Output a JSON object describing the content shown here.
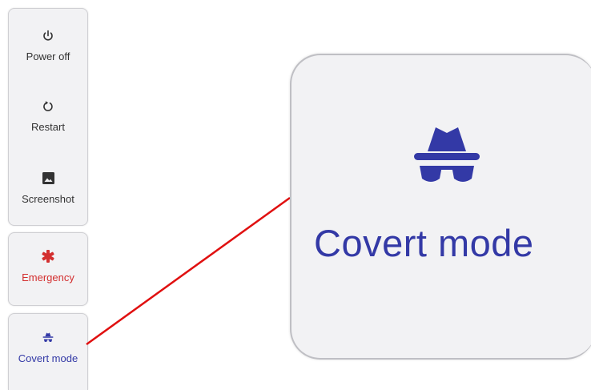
{
  "power_menu": {
    "items": [
      {
        "label": "Power off",
        "icon": "power-icon"
      },
      {
        "label": "Restart",
        "icon": "restart-icon"
      },
      {
        "label": "Screenshot",
        "icon": "screenshot-icon"
      }
    ],
    "emergency": {
      "label": "Emergency",
      "icon": "emergency-icon",
      "color": "#d32f2f"
    },
    "covert": {
      "label": "Covert mode",
      "icon": "incognito-icon",
      "color": "#3339a6"
    }
  },
  "zoom": {
    "label": "Covert mode",
    "icon": "incognito-icon",
    "connector_color": "#e01010"
  }
}
